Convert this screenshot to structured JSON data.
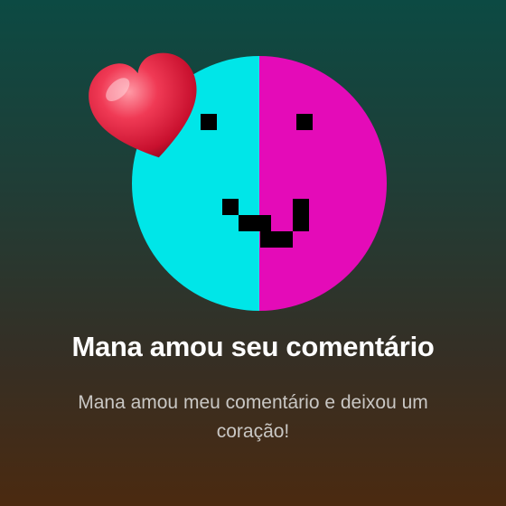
{
  "notification": {
    "title": "Mana amou seu comentário",
    "message": "Mana amou meu comentário e deixou um coração!"
  },
  "avatar": {
    "left_color": "#00e6e8",
    "right_color": "#e40bb8",
    "feature_color": "#000000"
  },
  "reaction": {
    "icon": "heart-icon",
    "color": "#e8254a"
  }
}
